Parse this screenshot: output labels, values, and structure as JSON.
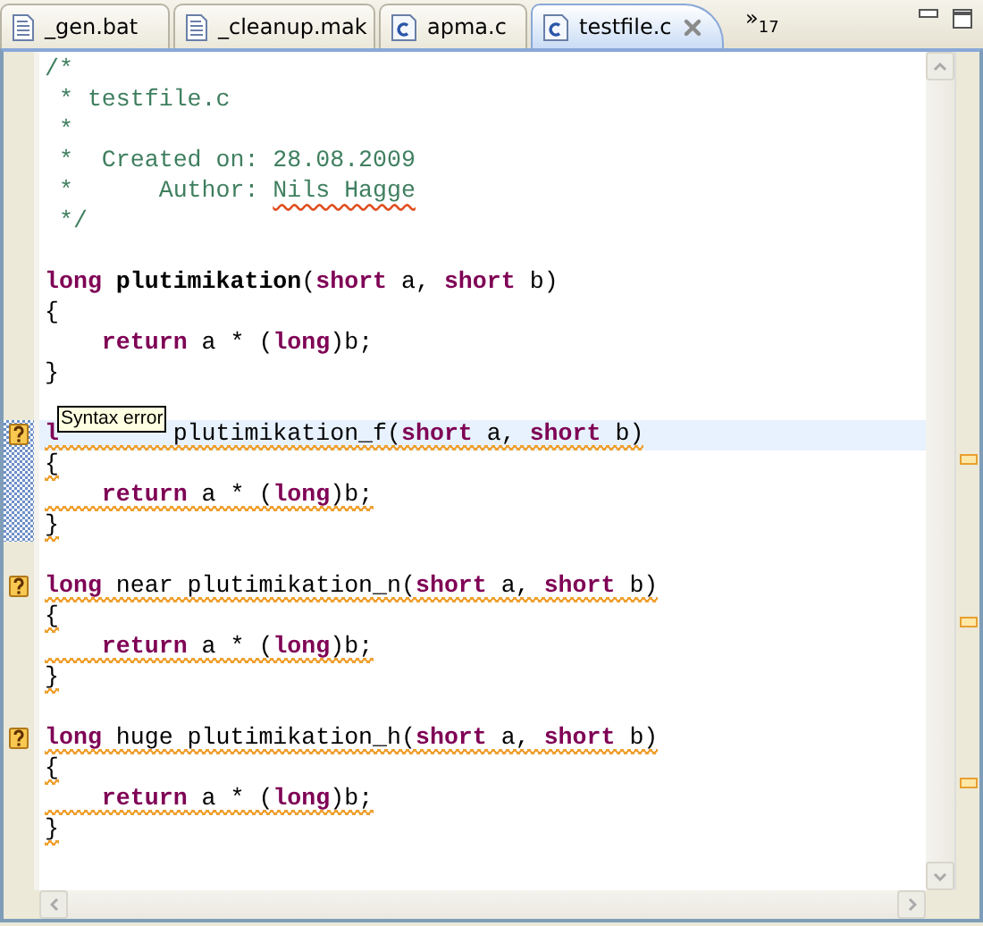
{
  "tabs": [
    {
      "label": "_gen.bat",
      "kind": "text",
      "selected": false,
      "closable": false
    },
    {
      "label": "_cleanup.mak",
      "kind": "text",
      "selected": false,
      "closable": false
    },
    {
      "label": "apma.c",
      "kind": "source",
      "selected": false,
      "closable": false
    },
    {
      "label": "testfile.c",
      "kind": "source",
      "selected": true,
      "closable": true
    }
  ],
  "overflow": {
    "chevron": "»",
    "count": "17"
  },
  "lines": [
    {
      "marker": false,
      "current": false,
      "in_range": false,
      "underlined": false,
      "segments": [
        {
          "kind": "comment",
          "text": "/*"
        }
      ]
    },
    {
      "marker": false,
      "current": false,
      "in_range": false,
      "underlined": false,
      "segments": [
        {
          "kind": "comment",
          "text": " * testfile.c"
        }
      ]
    },
    {
      "marker": false,
      "current": false,
      "in_range": false,
      "underlined": false,
      "segments": [
        {
          "kind": "comment",
          "text": " *"
        }
      ]
    },
    {
      "marker": false,
      "current": false,
      "in_range": false,
      "underlined": false,
      "segments": [
        {
          "kind": "comment",
          "text": " *  Created on: 28.08.2009"
        }
      ]
    },
    {
      "marker": false,
      "current": false,
      "in_range": false,
      "underlined": false,
      "segments": [
        {
          "kind": "comment",
          "text": " *      Author: "
        },
        {
          "kind": "spelling",
          "text": "Nils Hagge"
        }
      ]
    },
    {
      "marker": false,
      "current": false,
      "in_range": false,
      "underlined": false,
      "segments": [
        {
          "kind": "comment",
          "text": " */"
        }
      ]
    },
    {
      "marker": false,
      "current": false,
      "in_range": false
    },
    {
      "marker": false,
      "current": false,
      "in_range": false,
      "underlined": false,
      "segments": [
        {
          "kind": "keyword",
          "text": "long "
        },
        {
          "kind": "function",
          "text": "plutimikation"
        },
        {
          "kind": "plain",
          "text": "("
        },
        {
          "kind": "keyword",
          "text": "short"
        },
        {
          "kind": "plain",
          "text": " a, "
        },
        {
          "kind": "keyword",
          "text": "short"
        },
        {
          "kind": "plain",
          "text": " b)"
        }
      ]
    },
    {
      "marker": false,
      "current": false,
      "in_range": false,
      "underlined": false,
      "segments": [
        {
          "kind": "plain",
          "text": "{"
        }
      ]
    },
    {
      "marker": false,
      "current": false,
      "in_range": false,
      "underlined": false,
      "segments": [
        {
          "kind": "keyword",
          "text": "    return"
        },
        {
          "kind": "plain",
          "text": " a * ("
        },
        {
          "kind": "keyword",
          "text": "long"
        },
        {
          "kind": "plain",
          "text": ")b;"
        }
      ]
    },
    {
      "marker": false,
      "current": false,
      "in_range": false,
      "underlined": false,
      "segments": [
        {
          "kind": "plain",
          "text": "}"
        }
      ]
    },
    {
      "marker": false,
      "current": false,
      "in_range": false
    },
    {
      "marker": true,
      "current": true,
      "in_range": true,
      "underlined": true,
      "tooltip": "Syntax error",
      "segments": [
        {
          "kind": "keyword",
          "text": "l"
        },
        {
          "kind": "plain",
          "text": "        plutimikation_f("
        },
        {
          "kind": "keyword",
          "text": "short"
        },
        {
          "kind": "plain",
          "text": " a, "
        },
        {
          "kind": "keyword",
          "text": "short"
        },
        {
          "kind": "plain",
          "text": " b)"
        }
      ]
    },
    {
      "marker": false,
      "current": false,
      "in_range": true,
      "underlined": true,
      "segments": [
        {
          "kind": "plain",
          "text": "{"
        }
      ]
    },
    {
      "marker": false,
      "current": false,
      "in_range": true,
      "underlined": true,
      "segments": [
        {
          "kind": "keyword",
          "text": "    return"
        },
        {
          "kind": "plain",
          "text": " a * ("
        },
        {
          "kind": "keyword",
          "text": "long"
        },
        {
          "kind": "plain",
          "text": ")b;"
        }
      ]
    },
    {
      "marker": false,
      "current": false,
      "in_range": true,
      "underlined": true,
      "segments": [
        {
          "kind": "plain",
          "text": "}"
        }
      ]
    },
    {
      "marker": false,
      "current": false,
      "in_range": false
    },
    {
      "marker": true,
      "current": false,
      "in_range": false,
      "underlined": true,
      "segments": [
        {
          "kind": "keyword",
          "text": "long"
        },
        {
          "kind": "plain",
          "text": " near plutimikation_n("
        },
        {
          "kind": "keyword",
          "text": "short"
        },
        {
          "kind": "plain",
          "text": " a, "
        },
        {
          "kind": "keyword",
          "text": "short"
        },
        {
          "kind": "plain",
          "text": " b)"
        }
      ]
    },
    {
      "marker": false,
      "current": false,
      "in_range": false,
      "underlined": true,
      "segments": [
        {
          "kind": "plain",
          "text": "{"
        }
      ]
    },
    {
      "marker": false,
      "current": false,
      "in_range": false,
      "underlined": true,
      "segments": [
        {
          "kind": "keyword",
          "text": "    return"
        },
        {
          "kind": "plain",
          "text": " a * ("
        },
        {
          "kind": "keyword",
          "text": "long"
        },
        {
          "kind": "plain",
          "text": ")b;"
        }
      ]
    },
    {
      "marker": false,
      "current": false,
      "in_range": false,
      "underlined": true,
      "segments": [
        {
          "kind": "plain",
          "text": "}"
        }
      ]
    },
    {
      "marker": false,
      "current": false,
      "in_range": false
    },
    {
      "marker": true,
      "current": false,
      "in_range": false,
      "underlined": true,
      "segments": [
        {
          "kind": "keyword",
          "text": "long"
        },
        {
          "kind": "plain",
          "text": " huge plutimikation_h("
        },
        {
          "kind": "keyword",
          "text": "short"
        },
        {
          "kind": "plain",
          "text": " a, "
        },
        {
          "kind": "keyword",
          "text": "short"
        },
        {
          "kind": "plain",
          "text": " b)"
        }
      ]
    },
    {
      "marker": false,
      "current": false,
      "in_range": false,
      "underlined": true,
      "segments": [
        {
          "kind": "plain",
          "text": "{"
        }
      ]
    },
    {
      "marker": false,
      "current": false,
      "in_range": false,
      "underlined": true,
      "segments": [
        {
          "kind": "keyword",
          "text": "    return"
        },
        {
          "kind": "plain",
          "text": " a * ("
        },
        {
          "kind": "keyword",
          "text": "long"
        },
        {
          "kind": "plain",
          "text": ")b;"
        }
      ]
    },
    {
      "marker": false,
      "current": false,
      "in_range": false,
      "underlined": true,
      "segments": [
        {
          "kind": "plain",
          "text": "}"
        }
      ]
    }
  ]
}
